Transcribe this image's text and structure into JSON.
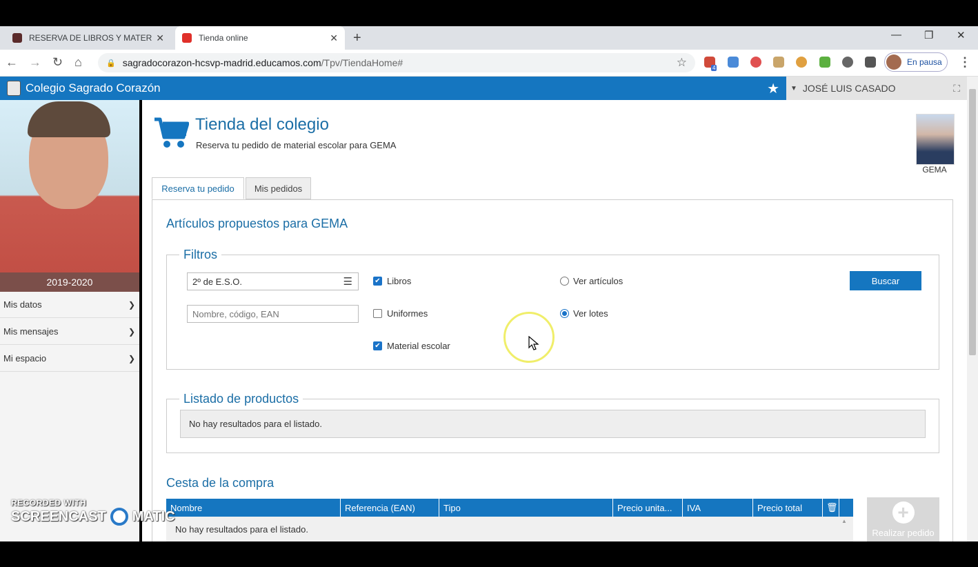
{
  "browser": {
    "tabs": [
      {
        "title": "RESERVA DE LIBROS Y MATERIAL",
        "active": false
      },
      {
        "title": "Tienda online",
        "active": true
      }
    ],
    "url_host": "sagradocorazon-hcsvp-madrid.educamos.com",
    "url_path": "/Tpv/TiendaHome#",
    "profile_label": "En pausa",
    "extension_badge": "4"
  },
  "app": {
    "school_name": "Colegio Sagrado Corazón",
    "user_name": "JOSÉ LUIS CASADO"
  },
  "sidebar": {
    "year": "2019-2020",
    "items": [
      {
        "label": "Mis datos"
      },
      {
        "label": "Mis mensajes"
      },
      {
        "label": "Mi espacio"
      }
    ]
  },
  "page": {
    "title": "Tienda del colegio",
    "subtitle": "Reserva tu pedido de material escolar para GEMA",
    "student_name": "GEMA",
    "tabs": [
      "Reserva tu pedido",
      "Mis pedidos"
    ],
    "section_title": "Artículos propuestos para GEMA"
  },
  "filters": {
    "legend": "Filtros",
    "course_value": "2º de E.S.O.",
    "search_placeholder": "Nombre, código, EAN",
    "checkboxes": [
      {
        "label": "Libros",
        "checked": true
      },
      {
        "label": "Uniformes",
        "checked": false
      },
      {
        "label": "Material escolar",
        "checked": true
      }
    ],
    "radios": [
      {
        "label": "Ver artículos",
        "selected": false
      },
      {
        "label": "Ver lotes",
        "selected": true
      }
    ],
    "search_button": "Buscar"
  },
  "products": {
    "legend": "Listado de productos",
    "empty_text": "No hay resultados para el listado."
  },
  "cart": {
    "title": "Cesta de la compra",
    "columns": [
      "Nombre",
      "Referencia (EAN)",
      "Tipo",
      "Precio unita...",
      "IVA",
      "Precio total"
    ],
    "empty_text": "No hay resultados para el listado.",
    "order_button": "Realizar pedido"
  },
  "watermark": {
    "line1": "RECORDED WITH",
    "line2a": "SCREENCAST",
    "line2b": "MATIC"
  }
}
